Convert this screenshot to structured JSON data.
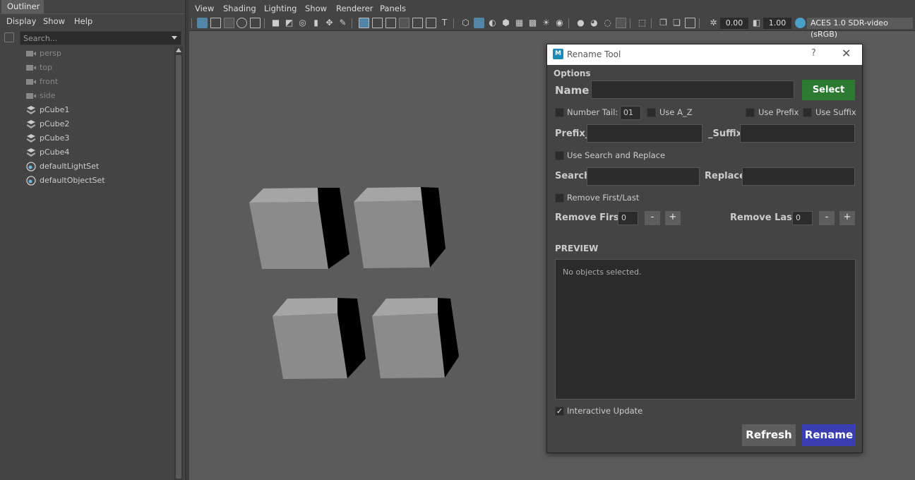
{
  "outliner": {
    "tab_label": "Outliner",
    "menu": [
      "Display",
      "Show",
      "Help"
    ],
    "search_placeholder": "Search...",
    "items": [
      {
        "label": "persp",
        "icon": "camera-icon"
      },
      {
        "label": "top",
        "icon": "camera-icon"
      },
      {
        "label": "front",
        "icon": "camera-icon"
      },
      {
        "label": "side",
        "icon": "camera-icon"
      },
      {
        "label": "pCube1",
        "icon": "transform-icon"
      },
      {
        "label": "pCube2",
        "icon": "transform-icon"
      },
      {
        "label": "pCube3",
        "icon": "transform-icon"
      },
      {
        "label": "pCube4",
        "icon": "transform-icon"
      },
      {
        "label": "defaultLightSet",
        "icon": "set-icon"
      },
      {
        "label": "defaultObjectSet",
        "icon": "set-icon"
      }
    ]
  },
  "viewport": {
    "menu": [
      "View",
      "Shading",
      "Lighting",
      "Show",
      "Renderer",
      "Panels"
    ],
    "exposure": "0.00",
    "gamma": "1.00",
    "color_space": "ACES 1.0 SDR-video (sRGB)",
    "background_color": "#5b5b5b"
  },
  "dialog": {
    "title": "Rename Tool",
    "help_glyph": "?",
    "close_glyph": "✕",
    "logo_text": "M",
    "options_label": "Options",
    "name_label": "Name",
    "name_value": "",
    "select_label": "Select",
    "number_tail_label": "Number Tail:",
    "number_tail_value": "01",
    "use_az_label": "Use A_Z",
    "use_prefix_label": "Use Prefix",
    "use_suffix_label": "Use Suffix",
    "prefix_label": "Prefix_",
    "suffix_label": "_Suffix",
    "use_search_replace_label": "Use Search and Replace",
    "search_label": "Search",
    "replace_label": "Replace",
    "remove_first_last_label": "Remove First/Last",
    "remove_first_label": "Remove First:",
    "remove_first_value": "0",
    "remove_last_label": "Remove Last:",
    "remove_last_value": "0",
    "minus": "-",
    "plus": "+",
    "preview_label": "PREVIEW",
    "preview_text": "No objects selected.",
    "interactive_update_label": "Interactive Update",
    "checkmark": "✓",
    "refresh_label": "Refresh",
    "rename_label": "Rename",
    "colors": {
      "select": "#2d7b32",
      "rename": "#3a3eb0",
      "refresh": "#5d5d5d"
    }
  }
}
